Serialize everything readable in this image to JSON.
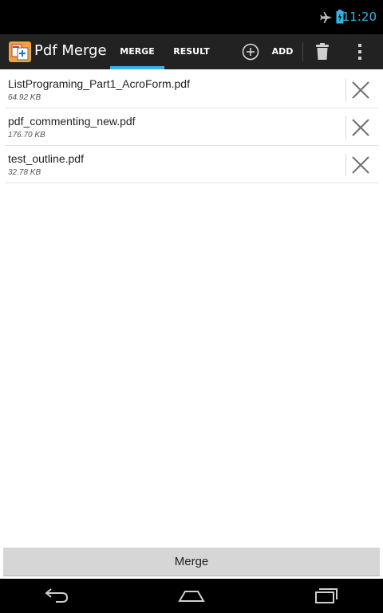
{
  "status_bar": {
    "time": "11:20",
    "icons": [
      "airplane-mode-icon",
      "battery-charging-icon"
    ],
    "accent_color": "#33b5e5"
  },
  "action_bar": {
    "app_title": "Pdf Merge",
    "app_icon": "pdf-merge-app-icon",
    "tabs": [
      {
        "label": "MERGE",
        "selected": true
      },
      {
        "label": "RESULT",
        "selected": false
      }
    ],
    "add_label": "ADD",
    "actions": [
      "add-circle-icon",
      "trash-icon",
      "overflow-menu-icon"
    ]
  },
  "files": [
    {
      "name": "ListPrograming_Part1_AcroForm.pdf",
      "size": "64.92 KB"
    },
    {
      "name": "pdf_commenting_new.pdf",
      "size": "176.70 KB"
    },
    {
      "name": "test_outline.pdf",
      "size": "32.78 KB"
    }
  ],
  "merge_button_label": "Merge",
  "nav_bar": {
    "icons": [
      "back-icon",
      "home-icon",
      "recent-apps-icon"
    ]
  }
}
